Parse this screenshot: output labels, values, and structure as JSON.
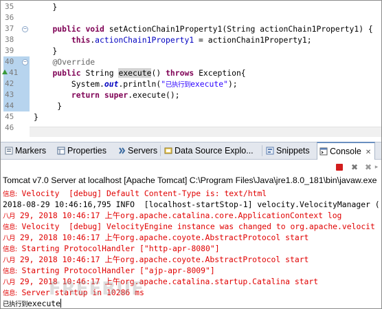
{
  "editor": {
    "lines": [
      {
        "num": "35",
        "text": "    }"
      },
      {
        "num": "36",
        "text": ""
      },
      {
        "num": "37",
        "text": "    public void setActionChain1Property1(String actionChain1Property1) {"
      },
      {
        "num": "38",
        "text": "        this.actionChain1Property1 = actionChain1Property1;"
      },
      {
        "num": "39",
        "text": "    }"
      },
      {
        "num": "40",
        "text": "    @Override"
      },
      {
        "num": "41",
        "text": "    public String execute() throws Exception{"
      },
      {
        "num": "42",
        "text": "        System.out.println(\"已执行到execute\");"
      },
      {
        "num": "43",
        "text": "        return super.execute();"
      },
      {
        "num": "44",
        "text": "     }"
      },
      {
        "num": "45",
        "text": "}"
      },
      {
        "num": "46",
        "text": ""
      }
    ]
  },
  "tabs": [
    {
      "label": "Markers",
      "icon": "markers-icon"
    },
    {
      "label": "Properties",
      "icon": "properties-icon"
    },
    {
      "label": "Servers",
      "icon": "servers-icon"
    },
    {
      "label": "Data Source Explo...",
      "icon": "data-source-icon"
    },
    {
      "label": "Snippets",
      "icon": "snippets-icon"
    },
    {
      "label": "Console",
      "icon": "console-icon"
    }
  ],
  "active_tab": "Console",
  "console": {
    "header": "Tomcat v7.0 Server at localhost [Apache Tomcat] C:\\Program Files\\Java\\jre1.8.0_181\\bin\\javaw.exe",
    "lines": [
      {
        "prefix": "信息:",
        "text": " Velocity  [debug] Default Content-Type is: text/html",
        "color": "red"
      },
      {
        "prefix": "",
        "text": "2018-08-29 10:46:16,795 INFO  [localhost-startStop-1] velocity.VelocityManager (",
        "color": "black"
      },
      {
        "prefix": "八月",
        "text": " 29, 2018 10:46:17 上午org.apache.catalina.core.ApplicationContext log",
        "color": "red"
      },
      {
        "prefix": "信息:",
        "text": " Velocity  [debug] VelocityEngine instance was changed to org.apache.velocit",
        "color": "red"
      },
      {
        "prefix": "八月",
        "text": " 29, 2018 10:46:17 上午org.apache.coyote.AbstractProtocol start",
        "color": "red"
      },
      {
        "prefix": "信息:",
        "text": " Starting ProtocolHandler [\"http-apr-8080\"]",
        "color": "red"
      },
      {
        "prefix": "八月",
        "text": " 29, 2018 10:46:17 上午org.apache.coyote.AbstractProtocol start",
        "color": "red"
      },
      {
        "prefix": "信息:",
        "text": " Starting ProtocolHandler [\"ajp-apr-8009\"]",
        "color": "red"
      },
      {
        "prefix": "八月",
        "text": " 29, 2018 10:46:17 上午org.apache.catalina.startup.Catalina start",
        "color": "red"
      },
      {
        "prefix": "信息:",
        "text": " Server startup in 10286 ms",
        "color": "red"
      },
      {
        "prefix": "已执行到",
        "text": "execute",
        "color": "black"
      }
    ]
  },
  "watermark": "FREEBUF",
  "colors": {
    "keyword": "#7f0055",
    "field": "#0000c0",
    "string": "#2a00ff",
    "annotation": "#646464",
    "error": "#e00000",
    "selection": "#b7d4ee"
  }
}
